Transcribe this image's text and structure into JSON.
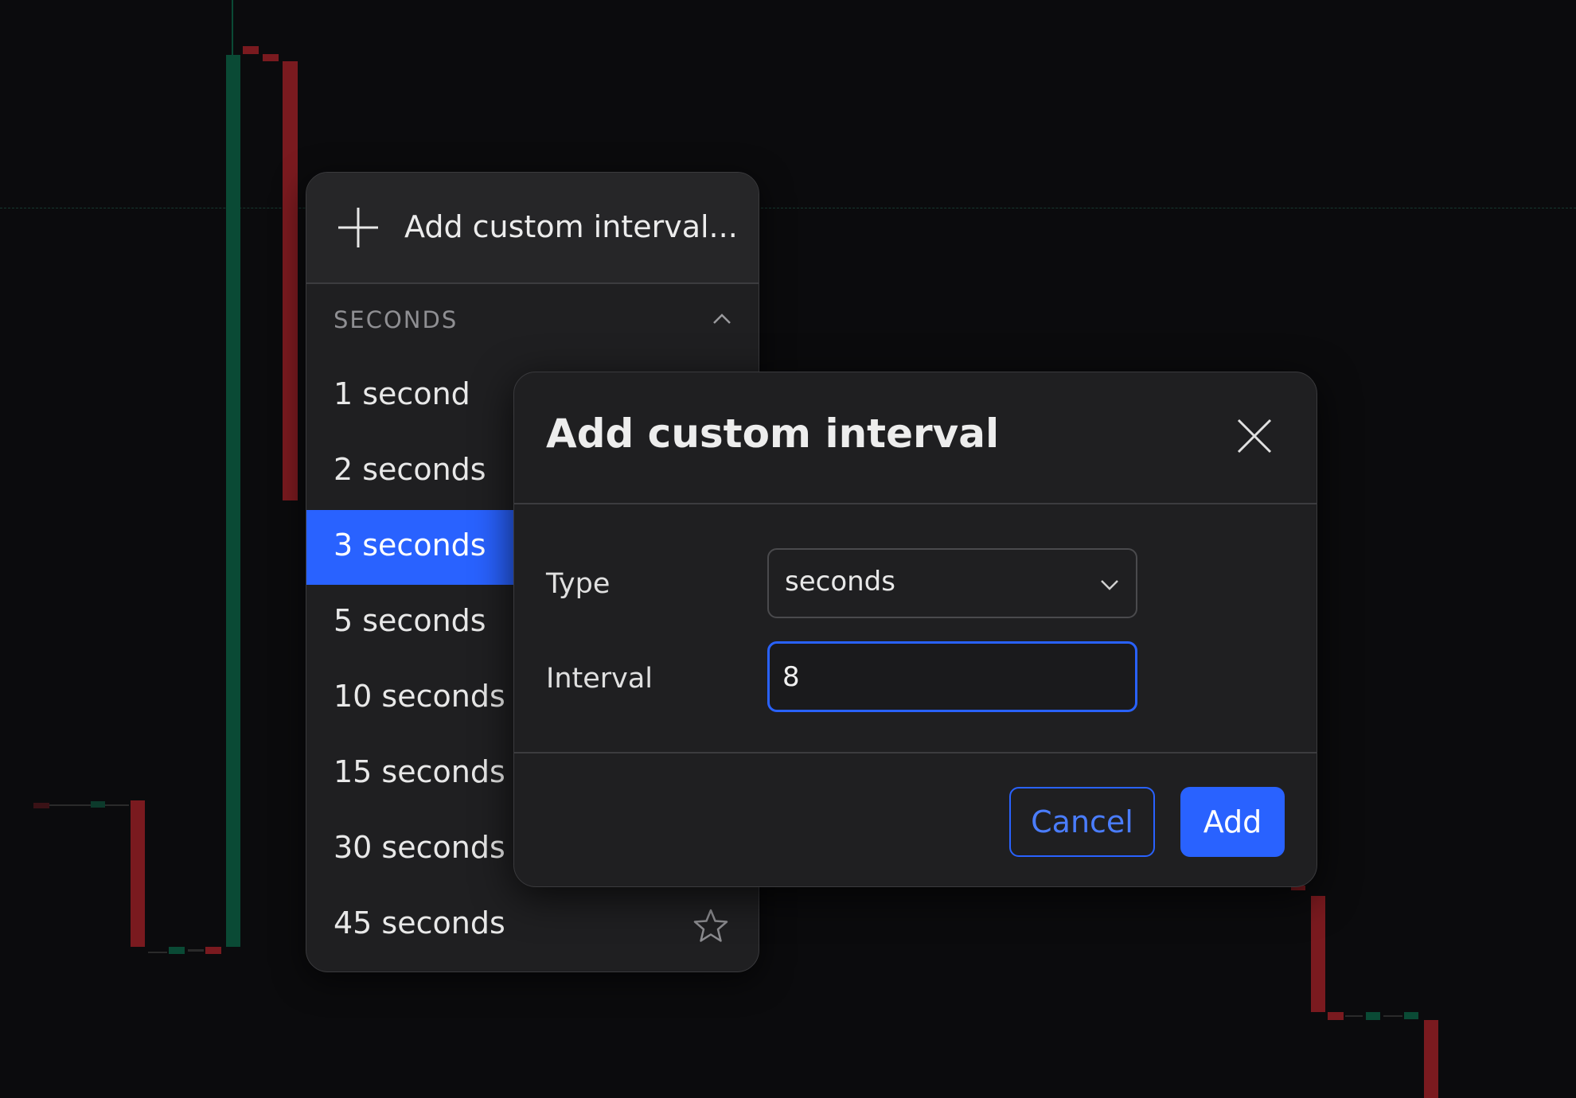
{
  "colors": {
    "background": "#0b0b0d",
    "panel": "#1f1f21",
    "accent": "#2962ff",
    "candle_up": "#0a4a35",
    "candle_down": "#7a1a1f"
  },
  "menu": {
    "add_custom_label": "Add custom interval...",
    "add_icon": "plus-icon",
    "section_title": "SECONDS",
    "section_icon": "chevron-up-icon",
    "selected_index": 2,
    "items": [
      {
        "label": "1 second"
      },
      {
        "label": "2 seconds"
      },
      {
        "label": "3 seconds"
      },
      {
        "label": "5 seconds"
      },
      {
        "label": "10 seconds"
      },
      {
        "label": "15 seconds"
      },
      {
        "label": "30 seconds"
      },
      {
        "label": "45 seconds",
        "icon": "star-icon"
      }
    ]
  },
  "dialog": {
    "title": "Add custom interval",
    "close_icon": "close-icon",
    "type_label": "Type",
    "type_value": "seconds",
    "type_icon": "chevron-down-icon",
    "interval_label": "Interval",
    "interval_value": "8",
    "cancel_label": "Cancel",
    "add_label": "Add"
  }
}
